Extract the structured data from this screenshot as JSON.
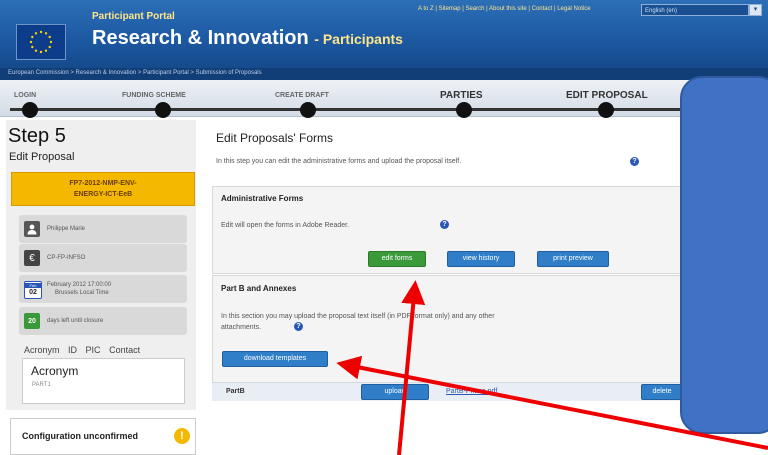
{
  "header": {
    "portal_small": "Participant Portal",
    "title_main": "Research & Innovation",
    "title_sub": "- Participants",
    "toplinks": "A to Z | Sitemap | Search | About this site | Contact | Legal Notice",
    "language": "English (en)"
  },
  "breadcrumb": "European Commission > Research & Innovation > Participant Portal > Submission of Proposals",
  "steps": [
    {
      "label": "LOGIN"
    },
    {
      "label": "FUNDING SCHEME"
    },
    {
      "label": "CREATE DRAFT"
    },
    {
      "label": "PARTIES"
    },
    {
      "label": "EDIT PROPOSAL"
    }
  ],
  "sidebar": {
    "step_title": "Step 5",
    "step_sub": "Edit Proposal",
    "proposal_id_line1": "FP7-2012-NMP-ENV-",
    "proposal_id_line2": "ENERGY-ICT-EeB",
    "user": "Philippe Marie",
    "call_code": "CP-FP-INFSO",
    "deadline_month": "Feb",
    "deadline_day": "02",
    "deadline_line1": "February 2012 17:00:00",
    "deadline_line2": "Brussels Local Time",
    "days_left": "20",
    "days_left_text": "days left until closure",
    "tabs": [
      "Acronym",
      "ID",
      "PIC",
      "Contact"
    ],
    "acronym_value": "Acronym",
    "acronym_code": "PART1",
    "config_text": "Configuration unconfirmed"
  },
  "main": {
    "title": "Edit Proposals' Forms",
    "intro": "In this step you can edit the administrative forms and upload the proposal itself.",
    "admin_title": "Administrative Forms",
    "admin_desc": "Edit will open the forms in Adobe Reader.",
    "btn_edit": "edit forms",
    "btn_history": "view history",
    "btn_preview": "print preview",
    "partb_title": "Part B and Annexes",
    "partb_desc1": "In this section you may upload the proposal text itself (in PDF format only) and any other",
    "partb_desc2": "attachments.",
    "btn_download": "download templates",
    "partb_label": "PartB",
    "btn_upload": "upload",
    "partb_file": "PartB-Phase.pdf",
    "btn_delete": "delete"
  },
  "colors": {
    "header_blue": "#1d5aa3",
    "accent_yellow": "#f5b800",
    "button_green": "#3a9a3a",
    "button_blue": "#2f7ec7",
    "overlay_blue": "#3f71c4",
    "arrow_red": "#ee0000"
  }
}
